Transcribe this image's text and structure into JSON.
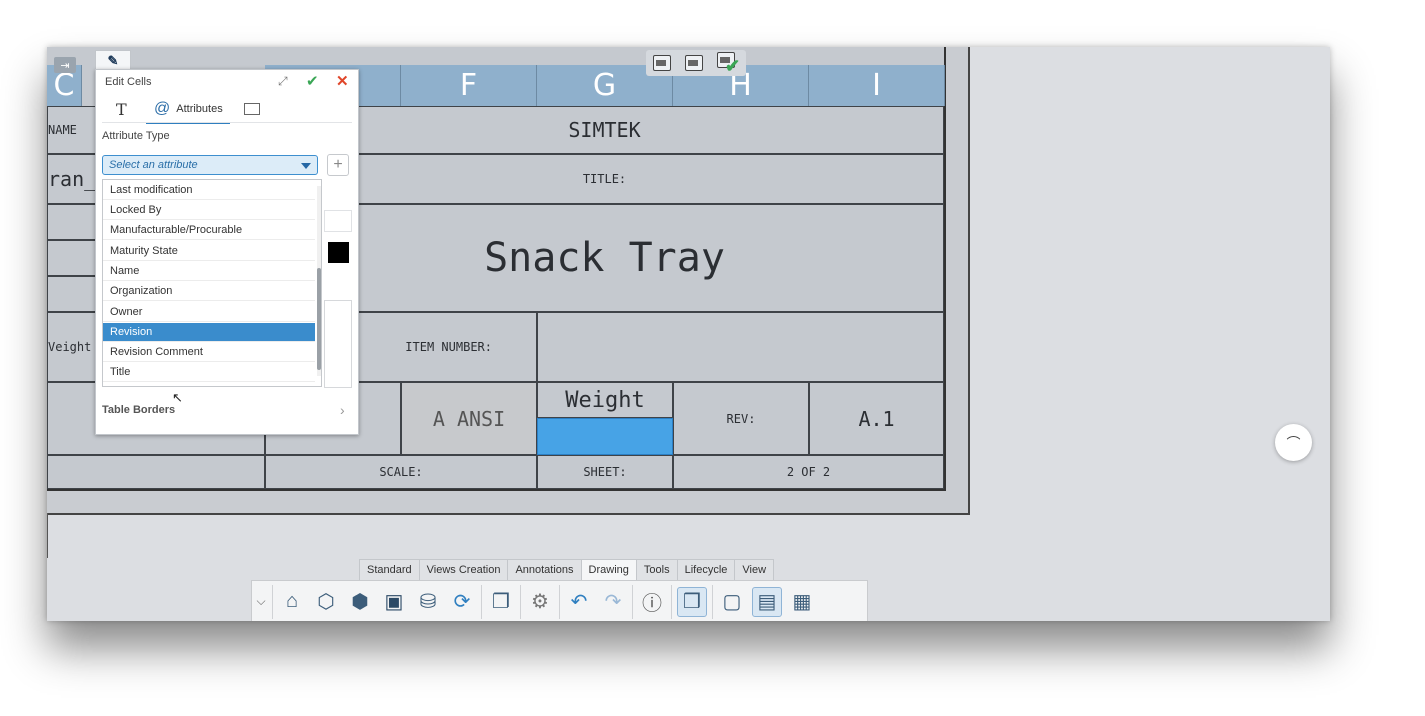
{
  "columns": [
    "C",
    "F",
    "G",
    "H",
    "I"
  ],
  "title_block": {
    "company": "SIMTEK",
    "title_label": "TITLE:",
    "title_value": "Snack Tray",
    "item_number_label": "ITEM NUMBER:",
    "size_value": "A ANSI",
    "weight_label": "Weight",
    "rev_label": "REV:",
    "rev_value": "A.1",
    "scale_label": "SCALE:",
    "sheet_label": "SHEET:",
    "sheet_value": "2 OF 2"
  },
  "left_partial": {
    "name_label": "NAME",
    "name_value": "ran_",
    "weight_label": "Veight"
  },
  "panel": {
    "tab_icon": "edit-cells-icon",
    "title": "Edit Cells",
    "tabs": [
      {
        "label": "T",
        "icon": "text-icon"
      },
      {
        "label": "Attributes",
        "icon": "at-icon",
        "active": true
      },
      {
        "label": "",
        "icon": "image-icon"
      }
    ],
    "attribute_type_label": "Attribute Type",
    "select_placeholder": "Select an attribute",
    "options": [
      "Last modification",
      "Locked By",
      "Manufacturable/Procurable",
      "Maturity State",
      "Name",
      "Organization",
      "Owner",
      "Revision",
      "Revision Comment",
      "Title"
    ],
    "selected_option": "Revision",
    "table_borders_label": "Table Borders"
  },
  "bottom_tabs": [
    "Standard",
    "Views Creation",
    "Annotations",
    "Drawing",
    "Tools",
    "Lifecycle",
    "View"
  ],
  "active_tab": "Drawing",
  "colors": {
    "accent": "#3a8ccc",
    "header": "#8fb0cc",
    "highlight_cell": "#47a3e6",
    "confirm": "#3aa655",
    "cancel": "#e0462a"
  }
}
